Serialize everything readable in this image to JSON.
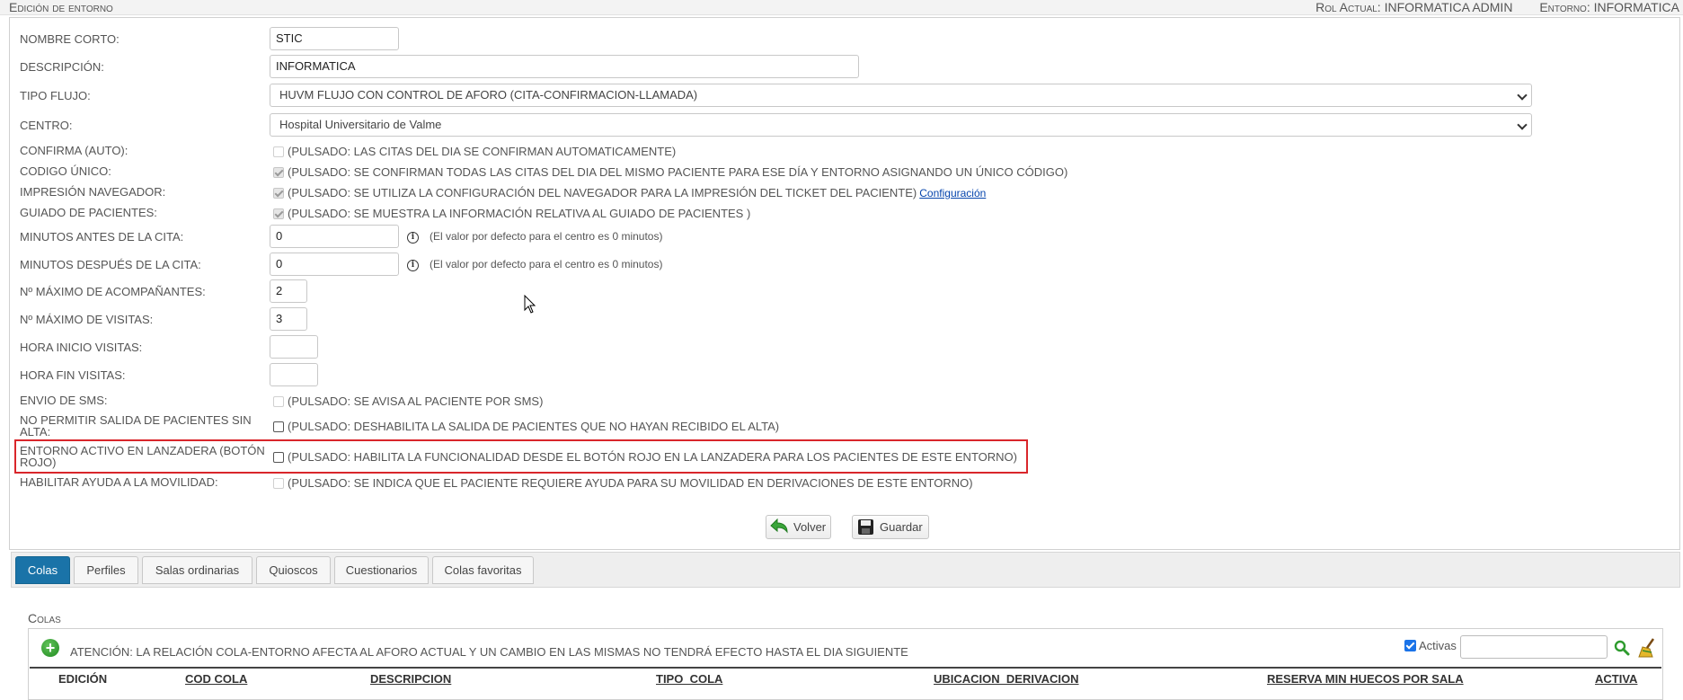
{
  "header": {
    "title": "Edición de entorno",
    "rol_actual": "Rol Actual: INFORMATICA ADMIN",
    "entorno": "Entorno: INFORMATICA"
  },
  "form": {
    "nombre_corto": {
      "label": "Nombre corto:",
      "value": "STIC"
    },
    "descripcion": {
      "label": "Descripción:",
      "value": "INFORMATICA"
    },
    "tipo_flujo": {
      "label": "Tipo flujo:",
      "value": "HUVM FLUJO CON CONTROL DE AFORO (CITA-CONFIRMACION-LLAMADA)"
    },
    "centro": {
      "label": "Centro:",
      "value": "Hospital Universitario de Valme"
    },
    "confirma_auto": {
      "label": "Confirma (Auto):",
      "text": "(PULSADO: LAS CITAS DEL DIA SE CONFIRMAN AUTOMATICAMENTE)",
      "checked": false
    },
    "codigo_unico": {
      "label": "Codigo único:",
      "text": "(PULSADO: SE CONFIRMAN TODAS LAS CITAS DEL DIA DEL MISMO PACIENTE PARA ESE DÍA Y ENTORNO ASIGNANDO UN ÚNICO CÓDIGO)",
      "checked": true
    },
    "impresion_navegador": {
      "label": "Impresión navegador:",
      "text": "(PULSADO: SE UTILIZA LA CONFIGURACIÓN DEL NAVEGADOR PARA LA IMPRESIÓN DEL TICKET DEL PACIENTE)",
      "link": "Configuración",
      "checked": true
    },
    "guiado_pacientes": {
      "label": "Guiado de pacientes:",
      "text": "(PULSADO: SE MUESTRA LA INFORMACIÓN RELATIVA AL GUIADO DE PACIENTES )",
      "checked": true
    },
    "minutos_antes": {
      "label": "Minutos antes de la cita:",
      "value": "0",
      "hint": "(El valor por defecto para el centro es 0 minutos)"
    },
    "minutos_despues": {
      "label": "Minutos después de la cita:",
      "value": "0",
      "hint": "(El valor por defecto para el centro es 0 minutos)"
    },
    "max_acompanantes": {
      "label": "Nº máximo de acompañantes:",
      "value": "2"
    },
    "max_visitas": {
      "label": "Nº máximo de visitas:",
      "value": "3"
    },
    "hora_inicio": {
      "label": "Hora inicio visitas:",
      "value": ""
    },
    "hora_fin": {
      "label": "Hora fin visitas:",
      "value": ""
    },
    "envio_sms": {
      "label": "Envio de SMS:",
      "text": "(PULSADO: SE AVISA AL PACIENTE POR SMS)",
      "checked": false
    },
    "no_salida": {
      "label": "No permitir salida de pacientes sin alta:",
      "text": "(PULSADO: DESHABILITA LA SALIDA DE PACIENTES QUE NO HAYAN RECIBIDO EL ALTA)",
      "checked": false
    },
    "lanzadera": {
      "label": "Entorno activo en lanzadera (botón rojo)",
      "text": "(PULSADO: HABILITA LA FUNCIONALIDAD DESDE EL BOTÓN ROJO EN LA LANZADERA PARA LOS PACIENTES DE ESTE ENTORNO)",
      "checked": false
    },
    "movilidad": {
      "label": "Habilitar ayuda a la movilidad:",
      "text": "(PULSADO: SE INDICA QUE EL PACIENTE REQUIERE AYUDA PARA SU MOVILIDAD EN DERIVACIONES DE ESTE ENTORNO)",
      "checked": false
    }
  },
  "buttons": {
    "volver": "Volver",
    "guardar": "Guardar"
  },
  "tabs": [
    {
      "label": "Colas",
      "active": true
    },
    {
      "label": "Perfiles"
    },
    {
      "label": "Salas ordinarias"
    },
    {
      "label": "Quioscos"
    },
    {
      "label": "Cuestionarios"
    },
    {
      "label": "Colas favoritas"
    }
  ],
  "colas": {
    "title": "Colas",
    "notice": "Atención: La relación cola-entorno afecta al aforo actual y un cambio en las mismas no tendrá efecto hasta el dia siguiente",
    "activas_label": "Activas",
    "search_value": "",
    "columns": [
      "EDICIÓN",
      "COD COLA",
      "DESCRIPCION",
      "TIPO_COLA",
      "UBICACION_DERIVACION",
      "RESERVA MIN HUECOS POR SALA",
      "ACTIVA"
    ]
  },
  "colors": {
    "accent": "#1a73a8",
    "highlight_border": "#d9262b",
    "link": "#0645ad"
  },
  "icons": [
    "info-icon",
    "back-arrow-icon",
    "floppy-disk-icon",
    "add-icon",
    "search-icon",
    "broom-icon",
    "mouse-cursor-icon"
  ]
}
